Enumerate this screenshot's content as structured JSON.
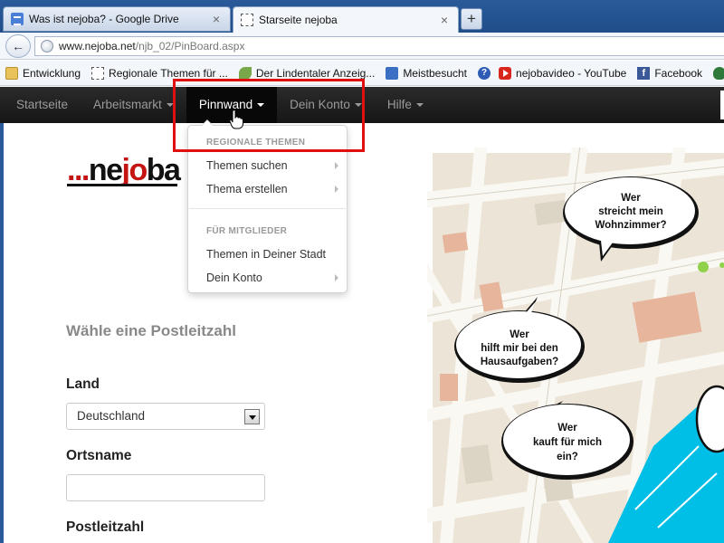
{
  "browser": {
    "tabs": [
      {
        "title": "Was ist nejoba? - Google Drive",
        "close": "×"
      },
      {
        "title": "Starseite nejoba",
        "close": "×"
      }
    ],
    "new_tab": "+",
    "back": "←",
    "url_domain": "www.nejoba.net",
    "url_path": "/njb_02/PinBoard.aspx",
    "bookmarks": [
      {
        "label": "Entwicklung",
        "icon": "folder-icon"
      },
      {
        "label": "Regionale Themen für ...",
        "icon": "page-icon"
      },
      {
        "label": "Der Lindentaler Anzeig...",
        "icon": "leaf-icon"
      },
      {
        "label": "Meistbesucht",
        "icon": "star-icon"
      },
      {
        "label": "",
        "icon": "help-icon"
      },
      {
        "label": "nejobavideo - YouTube",
        "icon": "youtube-icon"
      },
      {
        "label": "Facebook",
        "icon": "facebook-icon"
      },
      {
        "label": "",
        "icon": "green-icon"
      },
      {
        "label": "",
        "icon": "aspnet-icon"
      }
    ]
  },
  "nav": {
    "items": [
      {
        "label": "Startseite",
        "caret": false
      },
      {
        "label": "Arbeitsmarkt",
        "caret": true
      },
      {
        "label": "Pinnwand",
        "caret": true,
        "active": true
      },
      {
        "label": "Dein Konto",
        "caret": true
      },
      {
        "label": "Hilfe",
        "caret": true
      }
    ]
  },
  "dropdown": {
    "header1": "REGIONALE THEMEN",
    "item1": "Themen suchen",
    "item2": "Thema erstellen",
    "header2": "FÜR MITGLIEDER",
    "item3": "Themen in Deiner Stadt",
    "item4": "Dein Konto"
  },
  "logo": {
    "dots": "...",
    "part_a": "ne",
    "part_b": "jo",
    "part_c": "ba"
  },
  "form": {
    "title": "Wähle eine Postleitzahl",
    "land_label": "Land",
    "land_value": "Deutschland",
    "ort_label": "Ortsname",
    "ort_value": "",
    "plz_label": "Postleitzahl"
  },
  "bubbles": {
    "b1": [
      "Wer",
      "streicht mein",
      "Wohnzimmer?"
    ],
    "b2": [
      "Wer",
      "hilft mir bei den",
      "Hausaufgaben?"
    ],
    "b3": [
      "Wer",
      "kauft für mich",
      "ein?"
    ]
  },
  "colors": {
    "nav_bg": "#1b1b1b",
    "logo_red": "#c41414",
    "highlight": "#e01010",
    "map_road": "#f4f1ea",
    "map_block": "#ece4d6",
    "map_water": "#00bfe6"
  }
}
